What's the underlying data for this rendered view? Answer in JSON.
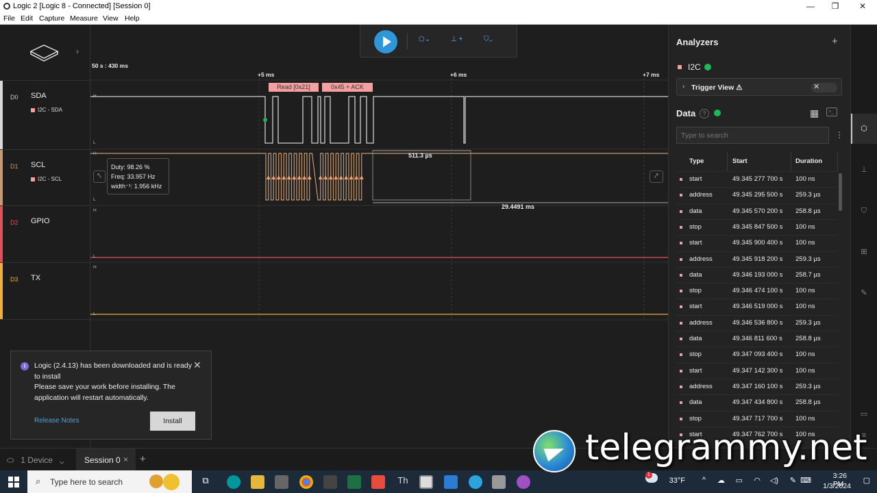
{
  "window": {
    "title": "Logic 2 [Logic 8 - Connected] [Session 0]",
    "minimize": "—",
    "maximize": "❐",
    "close": "✕"
  },
  "menu": [
    "File",
    "Edit",
    "Capture",
    "Measure",
    "View",
    "Help"
  ],
  "timeline": {
    "origin_label": "50 s : 430 ms",
    "ticks": [
      "+5 ms",
      "+6 ms",
      "+7 ms"
    ],
    "protocol_bubbles": [
      "Read [0x21]",
      "0x45 + ACK"
    ],
    "measure_width": "511.3 µs",
    "measure_span": "29.4491 ms",
    "tooltip": {
      "duty": "Duty: 98.26 %",
      "freq": "Freq: 33.957 Hz",
      "width": "width⁻¹: 1.956 kHz"
    },
    "hi": "H",
    "lo": "L"
  },
  "channels": [
    {
      "num": "D0",
      "name": "SDA",
      "sub": "I2C - SDA",
      "color": "#d9d9d9"
    },
    {
      "num": "D1",
      "name": "SCL",
      "sub": "I2C - SCL",
      "color": "#c79a73"
    },
    {
      "num": "D2",
      "name": "GPIO",
      "sub": "",
      "color": "#e0505a"
    },
    {
      "num": "D3",
      "name": "TX",
      "sub": "",
      "color": "#f0b040"
    }
  ],
  "analyzers": {
    "title": "Analyzers",
    "add": "+",
    "items": [
      {
        "name": "I2C"
      }
    ],
    "trigger_view": "Trigger View ⚠"
  },
  "data": {
    "title": "Data",
    "search_placeholder": "Type to search",
    "columns": [
      "Type",
      "Start",
      "Duration"
    ],
    "rows": [
      {
        "type": "start",
        "start": "49.345 277 700 s",
        "duration": "100 ns"
      },
      {
        "type": "address",
        "start": "49.345 295 500 s",
        "duration": "259.3 µs"
      },
      {
        "type": "data",
        "start": "49.345 570 200 s",
        "duration": "258.8 µs"
      },
      {
        "type": "stop",
        "start": "49.345 847 500 s",
        "duration": "100 ns"
      },
      {
        "type": "start",
        "start": "49.345 900 400 s",
        "duration": "100 ns"
      },
      {
        "type": "address",
        "start": "49.345 918 200 s",
        "duration": "259.3 µs"
      },
      {
        "type": "data",
        "start": "49.346 193 000 s",
        "duration": "258.7 µs"
      },
      {
        "type": "stop",
        "start": "49.346 474 100 s",
        "duration": "100 ns"
      },
      {
        "type": "start",
        "start": "49.346 519 000 s",
        "duration": "100 ns"
      },
      {
        "type": "address",
        "start": "49.346 536 800 s",
        "duration": "259.3 µs"
      },
      {
        "type": "data",
        "start": "49.346 811 600 s",
        "duration": "258.8 µs"
      },
      {
        "type": "stop",
        "start": "49.347 093 400 s",
        "duration": "100 ns"
      },
      {
        "type": "start",
        "start": "49.347 142 300 s",
        "duration": "100 ns"
      },
      {
        "type": "address",
        "start": "49.347 160 100 s",
        "duration": "259.3 µs"
      },
      {
        "type": "data",
        "start": "49.347 434 800 s",
        "duration": "258.8 µs"
      },
      {
        "type": "stop",
        "start": "49.347 717 700 s",
        "duration": "100 ns"
      },
      {
        "type": "start",
        "start": "49.347 762 700 s",
        "duration": "100 ns"
      }
    ]
  },
  "notification": {
    "line1": "Logic (2.4.13) has been downloaded and is ready to install",
    "line2": "Please save your work before installing. The application will restart automatically.",
    "release_notes": "Release Notes",
    "install": "Install",
    "close": "✕"
  },
  "bottombar": {
    "device": "1 Device",
    "session": "Session 0",
    "close": "×",
    "add": "+"
  },
  "taskbar": {
    "search_placeholder": "Type here to search",
    "temperature": "33°F",
    "time": "3:26 PM",
    "date": "1/3/2024",
    "badge": "1"
  },
  "watermark": "telegrammy.net",
  "colors": {
    "accent": "#2f96d8",
    "ok": "#1db954",
    "i2c": "#f4a0a0",
    "scl": "#c79a73",
    "gpio": "#e0505a",
    "tx": "#f0b040"
  }
}
